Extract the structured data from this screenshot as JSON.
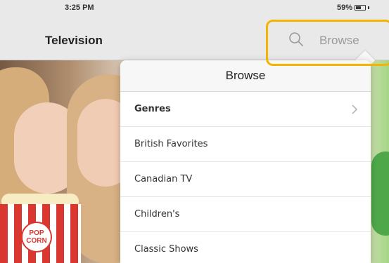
{
  "status_bar": {
    "time": "3:25 PM",
    "battery_percent": "59%",
    "battery_level": 0.59
  },
  "nav": {
    "title": "Television",
    "browse_label": "Browse",
    "search_icon": "search-icon"
  },
  "hero": {
    "popcorn_text": "POP\nCORN"
  },
  "popover": {
    "title": "Browse",
    "items": [
      {
        "label": "Genres",
        "bold": true,
        "has_chevron": true
      },
      {
        "label": "British Favorites",
        "bold": false,
        "has_chevron": false
      },
      {
        "label": "Canadian TV",
        "bold": false,
        "has_chevron": false
      },
      {
        "label": "Children's",
        "bold": false,
        "has_chevron": false
      },
      {
        "label": "Classic Shows",
        "bold": false,
        "has_chevron": false
      }
    ]
  },
  "colors": {
    "highlight": "#f4b400",
    "nav_bg": "#e9e9e9",
    "browse_gray": "#9a9a9a"
  }
}
